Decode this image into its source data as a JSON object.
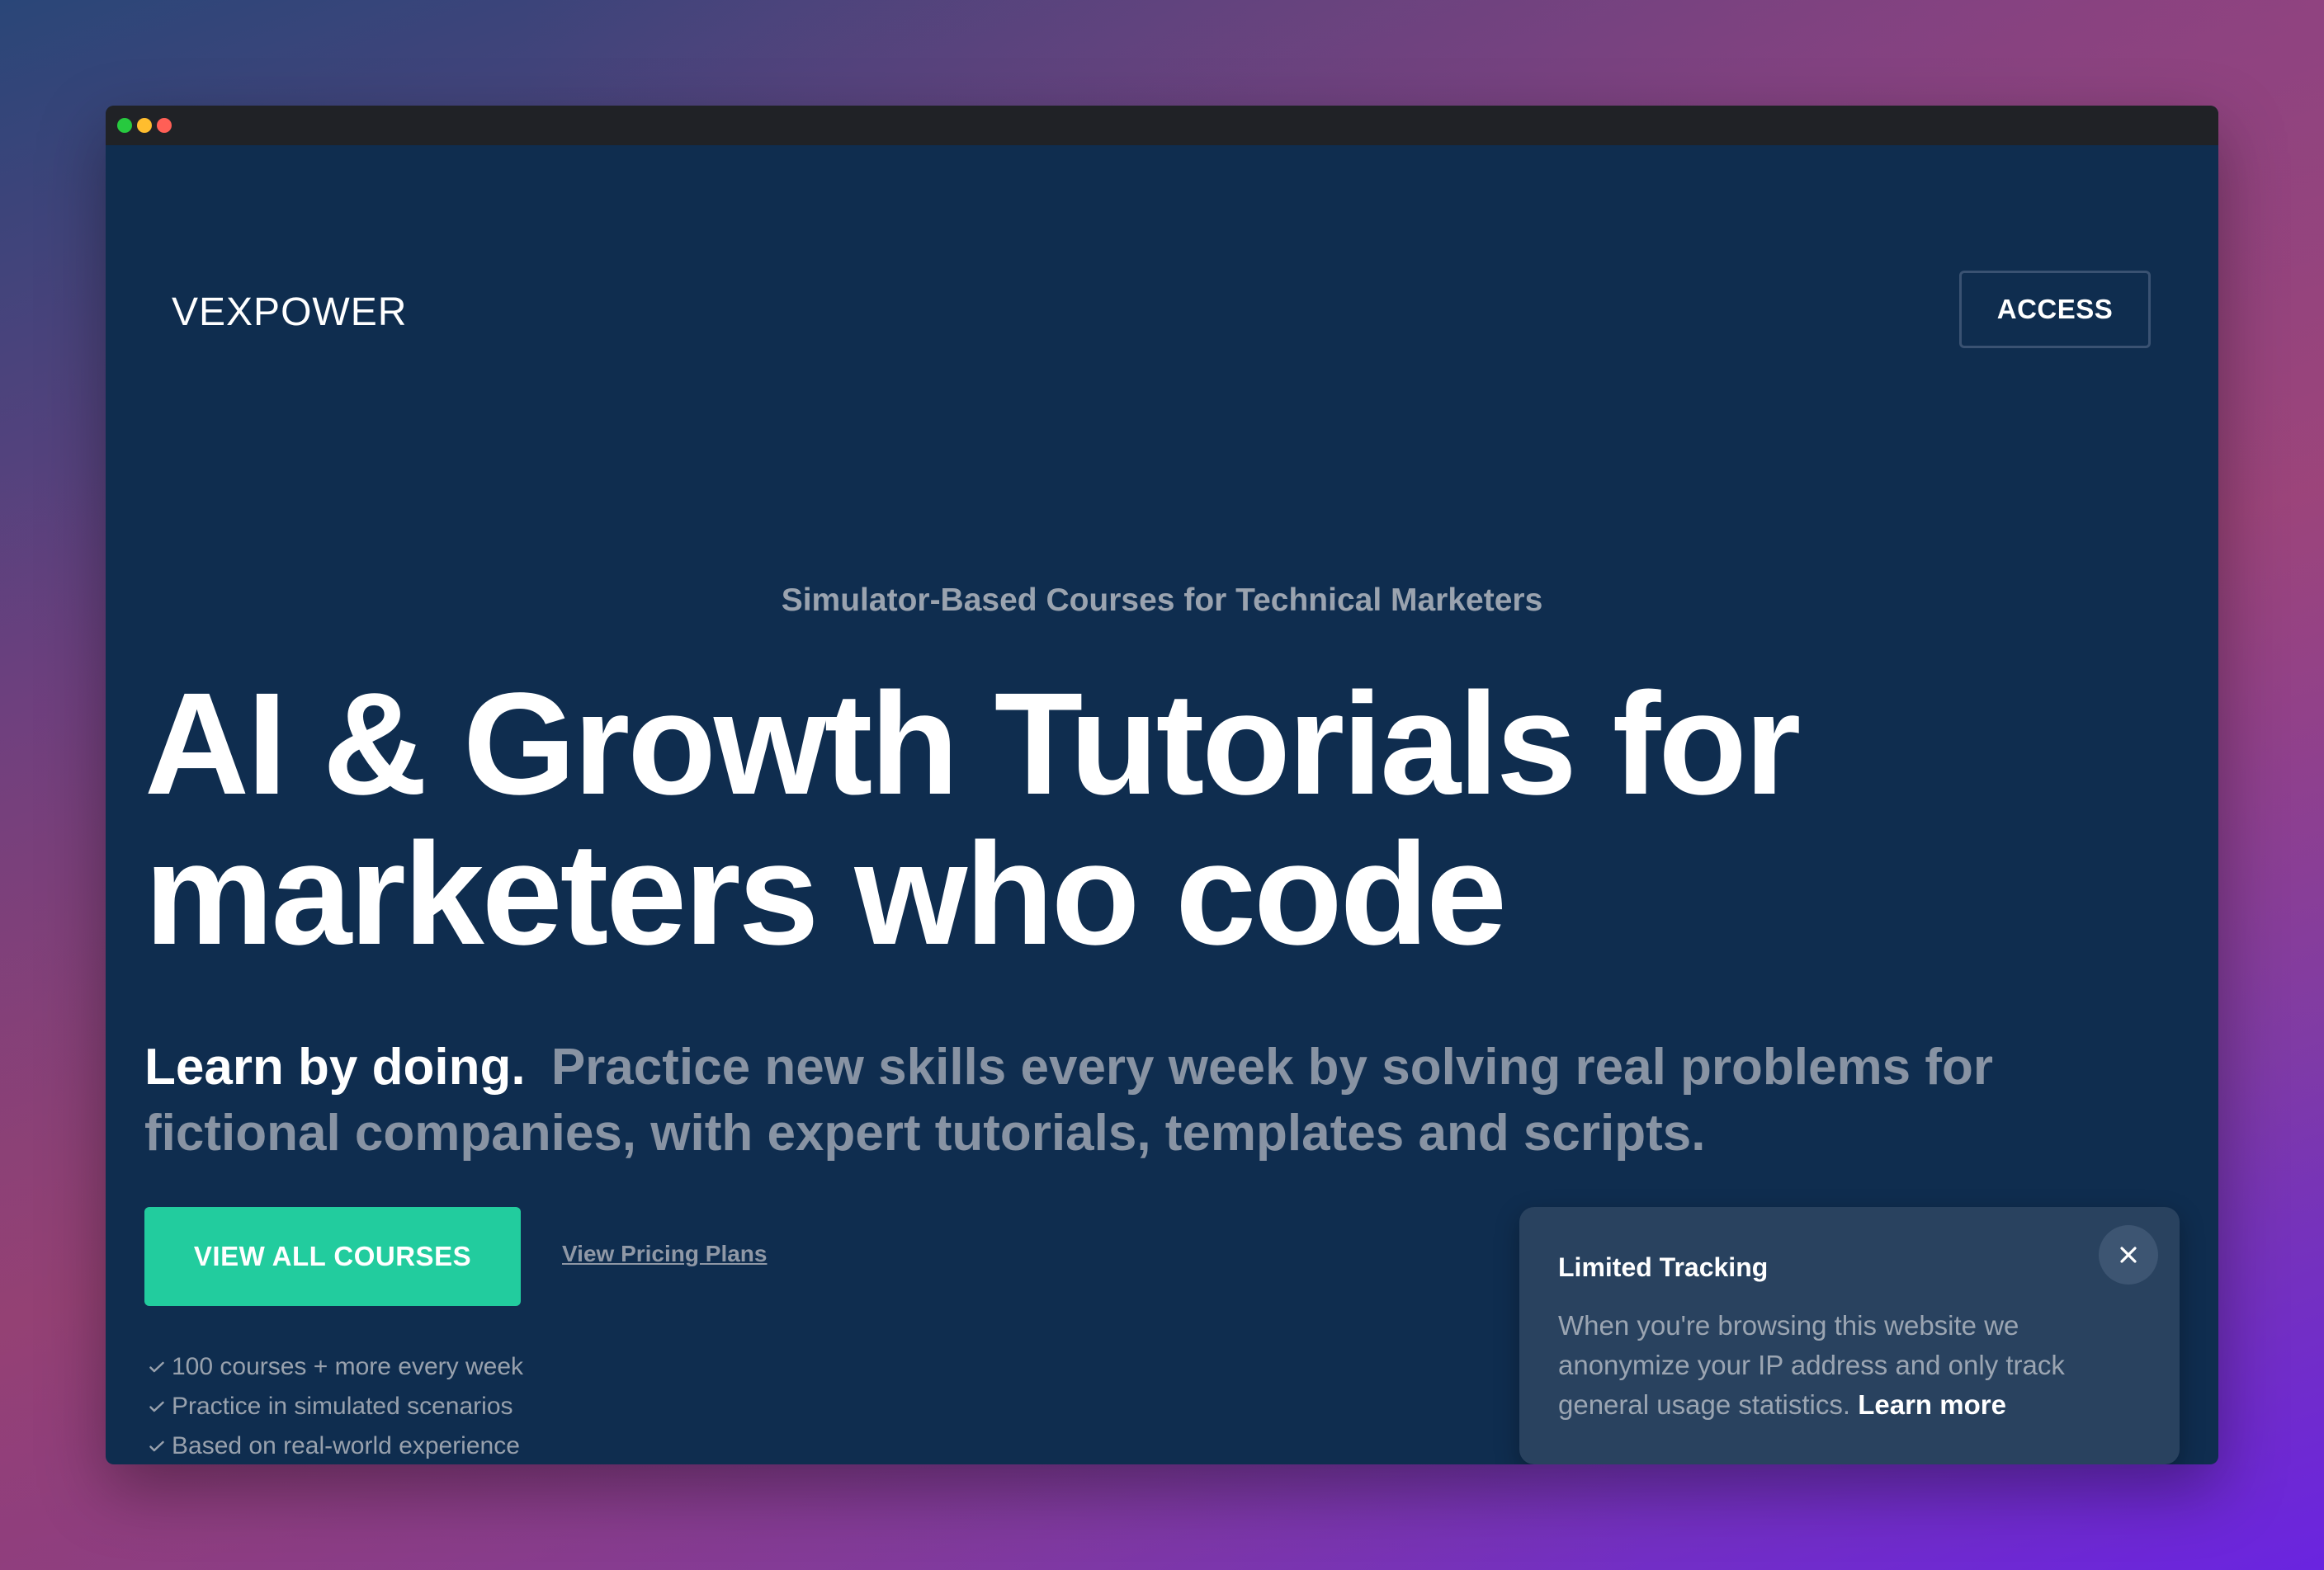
{
  "window": {
    "traffic_lights": [
      "#27c93f",
      "#ffbd2e",
      "#ff5f56"
    ]
  },
  "header": {
    "logo": "VEXPOWER",
    "access_label": "ACCESS"
  },
  "hero": {
    "kicker": "Simulator-Based Courses for Technical Marketers",
    "headline_line1": "AI & Growth Tutorials for",
    "headline_line2": "marketers who code",
    "sub_lead": "Learn by doing.",
    "sub_text": "Practice new skills every week by solving real problems for fictional companies, with expert tutorials, templates and scripts.",
    "primary_cta": "VIEW ALL COURSES",
    "secondary_cta": "View Pricing Plans",
    "features": [
      "100 courses + more every week",
      "Practice in simulated scenarios",
      "Based on real-world experience"
    ]
  },
  "toast": {
    "title": "Limited Tracking",
    "body": "When you're browsing this website we anonymize your IP address and only track general usage statistics.",
    "learn_more": "Learn more"
  },
  "colors": {
    "page_bg": "#0f2d4f",
    "accent": "#22cc9e",
    "toast_bg": "#29425f"
  }
}
